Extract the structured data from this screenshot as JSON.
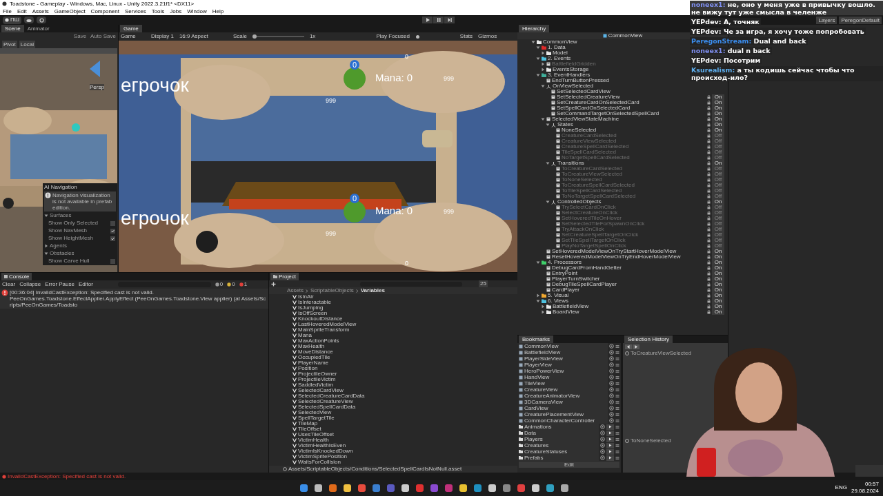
{
  "window": {
    "title": "Toadstone - Gameplay - Windows, Mac, Linux - Unity 2022.3.21f1* <DX11>"
  },
  "menu": [
    "File",
    "Edit",
    "Assets",
    "GameObject",
    "Component",
    "Services",
    "Tools",
    "Jobs",
    "Window",
    "Help"
  ],
  "toolbar": {
    "account": "ПШ",
    "layers": "Layers",
    "layout": "PeregonDefault"
  },
  "scene_panel": {
    "tabs": [
      {
        "label": "Scene",
        "selected": true
      },
      {
        "label": "Animator",
        "selected": false
      }
    ],
    "buttons": [
      "Save",
      "Auto Save"
    ],
    "tools": [
      "Pivot",
      "Local"
    ],
    "view_label": "Persp",
    "ai_navigation": {
      "title": "AI Navigation",
      "notice": "Navigation visualization is not available in prefab edition.",
      "sections": [
        {
          "label": "Surfaces",
          "expanded": true,
          "options": [
            {
              "label": "Show Only Selected",
              "checked": false
            },
            {
              "label": "Show NavMesh",
              "checked": true
            },
            {
              "label": "Show HeightMesh",
              "checked": true
            }
          ]
        },
        {
          "label": "Agents",
          "expanded": false
        },
        {
          "label": "Obstacles",
          "expanded": true,
          "options": [
            {
              "label": "Show Carve Hull",
              "checked": false
            }
          ]
        }
      ]
    }
  },
  "game_panel": {
    "tab": "Game",
    "toolbar": {
      "mode": "Game",
      "display": "Display 1",
      "aspect": "16:9 Aspect",
      "scale_label": "Scale",
      "level": 0,
      "scale": "1x",
      "play_mode": "Play Focused",
      "stats": "Stats",
      "gizmos": "Gizmos"
    },
    "players": [
      {
        "name": "егрочок",
        "badge": "0",
        "mana": "Mana: 0",
        "side_count": "999",
        "bottom_count": "999",
        "edge_number": "0"
      },
      {
        "name": "егрочок",
        "badge": "0",
        "mana": "Mana: 0",
        "side_count": "999",
        "bottom_count": "999",
        "edge_number": "0"
      }
    ]
  },
  "hierarchy": {
    "title": "Hierarchy",
    "scene": "CommonView",
    "tree": [
      {
        "label": "CommonView",
        "kind": "folder",
        "expanded": true,
        "active": true,
        "children": [
          {
            "label": "1. Data",
            "kind": "folder",
            "color": "#e02a2a",
            "expanded": true,
            "active": true,
            "children": [
              {
                "label": "Model",
                "kind": "folder",
                "expanded": false,
                "active": true
              }
            ]
          },
          {
            "label": "2. Events",
            "kind": "folder",
            "color": "#4fc3e0",
            "expanded": true,
            "active": true,
            "children": [
              {
                "label": "BattlefieldGridden",
                "kind": "object",
                "expanded": false,
                "active": false
              },
              {
                "label": "EventsStorage",
                "kind": "folder",
                "expanded": false,
                "active": true
              }
            ]
          },
          {
            "label": "3. EventHandlers",
            "kind": "folder",
            "color": "#3fae9a",
            "expanded": true,
            "active": true,
            "children": [
              {
                "label": "EndTurnButtonPressed",
                "kind": "object",
                "active": true
              },
              {
                "label": "OnViewSelected",
                "kind": "group",
                "expanded": true,
                "active": true,
                "children": [
                  {
                    "label": "SetSelectedCardView",
                    "kind": "object",
                    "active": true
                  },
                  {
                    "label": "SetSelectedCreatureView",
                    "kind": "object",
                    "active": true,
                    "toggle": "On"
                  },
                  {
                    "label": "SetCreatureCardOnSelectedCard",
                    "kind": "object",
                    "active": true,
                    "toggle": "On"
                  },
                  {
                    "label": "SetSpellCardOnSelectedCard",
                    "kind": "object",
                    "active": true,
                    "toggle": "On"
                  },
                  {
                    "label": "SetCommandTargetOnSelectedSpellCard",
                    "kind": "object",
                    "active": true,
                    "toggle": "On"
                  }
                ]
              },
              {
                "label": "SelectedViewStateMachine",
                "kind": "object",
                "expanded": true,
                "active": true,
                "toggle": "On",
                "children": [
                  {
                    "label": "States",
                    "kind": "group",
                    "expanded": true,
                    "active": true,
                    "toggle": "On",
                    "children": [
                      {
                        "label": "NoneSelected",
                        "kind": "object",
                        "active": true,
                        "toggle": "On"
                      },
                      {
                        "label": "CreatureCardSelected",
                        "kind": "object",
                        "active": false,
                        "toggle": "Off"
                      },
                      {
                        "label": "CreatureViewSelected",
                        "kind": "object",
                        "active": false,
                        "toggle": "Off"
                      },
                      {
                        "label": "CreatureSpellCardSelected",
                        "kind": "object",
                        "active": false,
                        "toggle": "Off"
                      },
                      {
                        "label": "TileSpellCardSelected",
                        "kind": "object",
                        "active": false,
                        "toggle": "Off"
                      },
                      {
                        "label": "NoTargetSpellCardSelected",
                        "kind": "object",
                        "active": false,
                        "toggle": "Off"
                      }
                    ]
                  },
                  {
                    "label": "Transitions",
                    "kind": "group",
                    "expanded": true,
                    "active": true,
                    "toggle": "On",
                    "children": [
                      {
                        "label": "ToCreatureCardSelected",
                        "kind": "object",
                        "active": false,
                        "toggle": "Off"
                      },
                      {
                        "label": "ToCreatureViewSelected",
                        "kind": "object",
                        "active": false,
                        "toggle": "Off"
                      },
                      {
                        "label": "ToNoneSelected",
                        "kind": "object",
                        "active": false,
                        "toggle": "Off"
                      },
                      {
                        "label": "ToCreatureSpellCardSelected",
                        "kind": "object",
                        "active": false,
                        "toggle": "Off"
                      },
                      {
                        "label": "ToTileSpellCardSelected",
                        "kind": "object",
                        "active": false,
                        "toggle": "Off"
                      },
                      {
                        "label": "ToNoTargetSpellCardSelected",
                        "kind": "object",
                        "active": false,
                        "toggle": "Off"
                      }
                    ]
                  },
                  {
                    "label": "ControlledObjects",
                    "kind": "group",
                    "expanded": true,
                    "active": true,
                    "toggle": "On",
                    "children": [
                      {
                        "label": "TrySelectCardOnClick",
                        "kind": "object",
                        "active": false,
                        "toggle": "Off"
                      },
                      {
                        "label": "SelectCreatureOnClick",
                        "kind": "object",
                        "active": false,
                        "toggle": "Off"
                      },
                      {
                        "label": "SetHoveredTileOnHover",
                        "kind": "object",
                        "active": false,
                        "toggle": "Off"
                      },
                      {
                        "label": "SetSelectedTileForSpawnOnClick",
                        "kind": "object",
                        "active": false,
                        "toggle": "Off"
                      },
                      {
                        "label": "TryAttackOnClick",
                        "kind": "object",
                        "active": false,
                        "toggle": "Off"
                      },
                      {
                        "label": "SetCreatureSpellTargetOnClick",
                        "kind": "object",
                        "active": false,
                        "toggle": "Off"
                      },
                      {
                        "label": "SetTileSpellTargetOnClick",
                        "kind": "object",
                        "active": false,
                        "toggle": "Off"
                      },
                      {
                        "label": "PlayNoTargetSpellOnClick",
                        "kind": "object",
                        "active": false,
                        "toggle": "Off"
                      }
                    ]
                  }
                ]
              },
              {
                "label": "SetHoveredModelViewOnTryStartHoverModelView",
                "kind": "object",
                "active": true,
                "toggle": "On"
              },
              {
                "label": "ResetHoveredModelViewOnTryEndHoverModelView",
                "kind": "object",
                "active": true,
                "toggle": "On"
              }
            ]
          },
          {
            "label": "4. Processors",
            "kind": "folder",
            "color": "#3fcf6a",
            "expanded": true,
            "active": true,
            "toggle": "On",
            "children": [
              {
                "label": "DebugCardFromHandGetter",
                "kind": "object",
                "active": true,
                "toggle": "On"
              },
              {
                "label": "EntryPoint",
                "kind": "object",
                "active": true,
                "toggle": "On"
              },
              {
                "label": "PlayerTurnSwitcher",
                "kind": "object",
                "active": true,
                "toggle": "On"
              },
              {
                "label": "DebugTileSpellCardPlayer",
                "kind": "object",
                "active": true,
                "toggle": "On"
              },
              {
                "label": "CardPlayer",
                "kind": "object",
                "active": true,
                "toggle": "On"
              }
            ]
          },
          {
            "label": "5. Visual",
            "kind": "folder",
            "color": "#f0a830",
            "expanded": false,
            "active": true,
            "toggle": "On"
          },
          {
            "label": "6. Views",
            "kind": "folder",
            "color": "#4fc3e0",
            "expanded": true,
            "active": true,
            "toggle": "On",
            "children": [
              {
                "label": "BattlefieldView",
                "kind": "folder",
                "expanded": false,
                "active": true,
                "toggle": "On"
              },
              {
                "label": "BoardView",
                "kind": "folder",
                "expanded": false,
                "active": true,
                "toggle": "On"
              }
            ]
          }
        ]
      }
    ]
  },
  "console": {
    "tab": "Console",
    "buttons": [
      "Clear",
      "Collapse",
      "Error Pause",
      "Editor"
    ],
    "counts": [
      {
        "kind": "log",
        "count": "0"
      },
      {
        "kind": "warning",
        "count": "0"
      },
      {
        "kind": "error",
        "count": "1"
      }
    ],
    "messages": [
      {
        "kind": "error",
        "lines": [
          "[00:36:04] InvalidCastException: Specified cast is not valid.",
          "PeeOnGames.Toadstone.EffectApplier.ApplyEffect (PeeOnGames.Toadstone.View applier) (at Assets/Scripts/PeeOnGames/Toadsto"
        ]
      }
    ]
  },
  "project": {
    "tab": "Project",
    "count": "25",
    "breadcrumb": [
      "Assets",
      "ScriptableObjects",
      "Variables"
    ],
    "items": [
      "IsInAir",
      "IsInteractable",
      "IsJumping",
      "IsOffScreen",
      "KnockoutDistance",
      "LastHoveredModelView",
      "MainSpriteTransform",
      "Mana",
      "MaxActionPoints",
      "MaxHealth",
      "MoveDistance",
      "OccupiedTile",
      "PlayerName",
      "Position",
      "ProjectileOwner",
      "ProjectileVictim",
      "SaddledVictim",
      "SelectedCardView",
      "SelectedCreatureCardData",
      "SelectedCreatureView",
      "SelectedSpellCardData",
      "SelectedView",
      "SpellTargetTile",
      "TileMap",
      "TileOffset",
      "UsesTileOffset",
      "VictimHealth",
      "VictimHealthIsEven",
      "VictimIsKnockedDown",
      "VictimSpritePosition",
      "WaitsForCollision"
    ],
    "path": "Assets/ScriptableObjects/Conditions/SelectedSpellCardIsNotNull.asset"
  },
  "bookmarks": {
    "title": "Bookmarks",
    "items": [
      {
        "label": "CommonView",
        "kind": "object"
      },
      {
        "label": "BattlefieldView",
        "kind": "object"
      },
      {
        "label": "PlayerSideView",
        "kind": "object"
      },
      {
        "label": "PlayerView",
        "kind": "object"
      },
      {
        "label": "HeroPowerView",
        "kind": "object"
      },
      {
        "label": "HandView",
        "kind": "object"
      },
      {
        "label": "TileView",
        "kind": "object"
      },
      {
        "label": "CreatureView",
        "kind": "object"
      },
      {
        "label": "CreatureAnimatorView",
        "kind": "object"
      },
      {
        "label": "3DCameraView",
        "kind": "object"
      },
      {
        "label": "CardView",
        "kind": "object"
      },
      {
        "label": "CreaturePlacementView",
        "kind": "object"
      },
      {
        "label": "CommonCharacterController",
        "kind": "object"
      },
      {
        "label": "Animations",
        "kind": "folder"
      },
      {
        "label": "Data",
        "kind": "folder"
      },
      {
        "label": "Players",
        "kind": "folder"
      },
      {
        "label": "Creatures",
        "kind": "folder"
      },
      {
        "label": "CreatureStatuses",
        "kind": "folder"
      },
      {
        "label": "Prefabs",
        "kind": "folder"
      }
    ],
    "edit": "Edit"
  },
  "selection_history": {
    "title": "Selection History",
    "items": [
      "ToCreatureViewSelected",
      "ToNoneSelected"
    ]
  },
  "chat": [
    {
      "user": "noneex1:",
      "color": "#7f8ff0",
      "text": "не, оно у меня уже в привычку вошло. не вижу тут уже смысла в челенже"
    },
    {
      "user": "YEPdev:",
      "color": "#ffffff",
      "text": "А, точняк"
    },
    {
      "user": "YEPdev:",
      "color": "#ffffff",
      "text": "Че за игра, я хочу тоже попробовать"
    },
    {
      "user": "PeregonStream:",
      "color": "#3b8ef0",
      "text": "Dual and back"
    },
    {
      "user": "noneex1:",
      "color": "#7f8ff0",
      "text": "dual n back"
    },
    {
      "user": "YEPdev:",
      "color": "#ffffff",
      "text": "Посотрим"
    },
    {
      "user": "Ksurealism:",
      "color": "#5fb0f0",
      "text": "а ты кодишь сейчас чтобы что происход-ило?"
    }
  ],
  "status_bar": {
    "message": "InvalidCastException: Specified cast is not valid."
  },
  "taskbar": {
    "language": "ENG",
    "time": "00:57",
    "date": "29.08.2024"
  }
}
